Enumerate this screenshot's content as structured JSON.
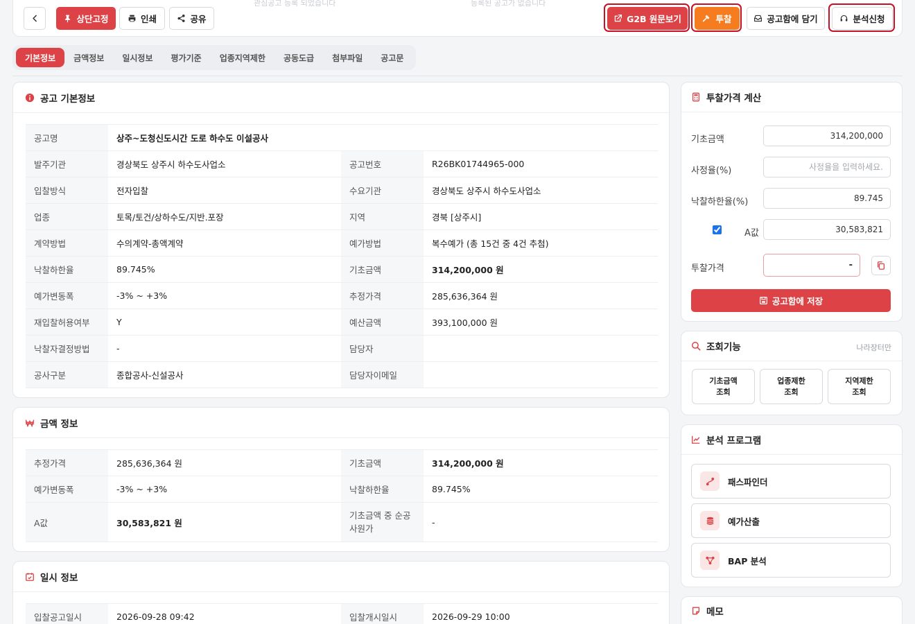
{
  "toolbar": {
    "ghost_left": "관심공고 등록 되었습니다",
    "ghost_right": "등록된 공고가 없습니다",
    "pin": "상단고정",
    "print": "인쇄",
    "share": "공유",
    "g2b": "G2B 원문보기",
    "bid": "투찰",
    "cart": "공고함에 담기",
    "analysis": "분석신청"
  },
  "tabs": [
    "기본정보",
    "금액정보",
    "일시정보",
    "평가기준",
    "업종지역제한",
    "공동도급",
    "첨부파일",
    "공고문"
  ],
  "basic": {
    "title": "공고 기본정보",
    "name_label": "공고명",
    "name_value": "상주~도청신도시간 도로 하수도 이설공사",
    "rows": [
      [
        "발주기관",
        "경상북도 상주시 하수도사업소",
        "공고번호",
        "R26BK01744965-000"
      ],
      [
        "입찰방식",
        "전자입찰",
        "수요기관",
        "경상북도 상주시 하수도사업소"
      ],
      [
        "업종",
        "토목/토건/상하수도/지반.포장",
        "지역",
        "경북 [상주시]"
      ],
      [
        "계약방법",
        "수의계약-총액계약",
        "예가방법",
        "복수예가 (총 15건 중 4건 추첨)"
      ],
      [
        "낙찰하한율",
        "89.745%",
        "기초금액",
        "314,200,000 원"
      ],
      [
        "예가변동폭",
        "-3% ~ +3%",
        "추정가격",
        "285,636,364 원"
      ],
      [
        "재입찰허용여부",
        "Y",
        "예산금액",
        "393,100,000 원"
      ],
      [
        "낙찰자결정방법",
        "-",
        "담당자",
        ""
      ],
      [
        "공사구분",
        "종합공사-신설공사",
        "담당자이메일",
        ""
      ]
    ]
  },
  "amount": {
    "title": "금액 정보",
    "rows": [
      [
        "추정가격",
        "285,636,364 원",
        "기초금액",
        "314,200,000 원"
      ],
      [
        "예가변동폭",
        "-3% ~ +3%",
        "낙찰하한율",
        "89.745%"
      ],
      [
        "A값",
        "30,583,821 원",
        "기초금액 중 순공사원가",
        "-"
      ]
    ]
  },
  "schedule": {
    "title": "일시 정보",
    "rows": [
      [
        "입찰공고일시",
        "2026-09-28 09:42",
        "입찰개시일시",
        "2026-09-29 10:00"
      ]
    ]
  },
  "calc": {
    "title": "투찰가격 계산",
    "base_label": "기초금액",
    "base_value": "314,200,000",
    "rate_label": "사정율(%)",
    "rate_placeholder": "사정율을 입력하세요.",
    "lower_label": "낙찰하한율(%)",
    "lower_value": "89.745",
    "a_label": "A값",
    "a_value": "30,583,821",
    "bid_label": "투찰가격",
    "bid_value": "-",
    "save": "공고함에 저장"
  },
  "lookup": {
    "title": "조회기능",
    "source": "나라장터만",
    "buttons": [
      "기초금액\n조회",
      "업종제한\n조회",
      "지역제한\n조회"
    ]
  },
  "programs": {
    "title": "분석 프로그램",
    "items": [
      "패스파인더",
      "예가산출",
      "BAP 분석"
    ]
  },
  "memo": {
    "title": "메모"
  },
  "colors": {
    "primary": "#dd4346",
    "bid": "#f57c1f",
    "highlight": "#c80f23",
    "accent_text": "#e85d14"
  }
}
